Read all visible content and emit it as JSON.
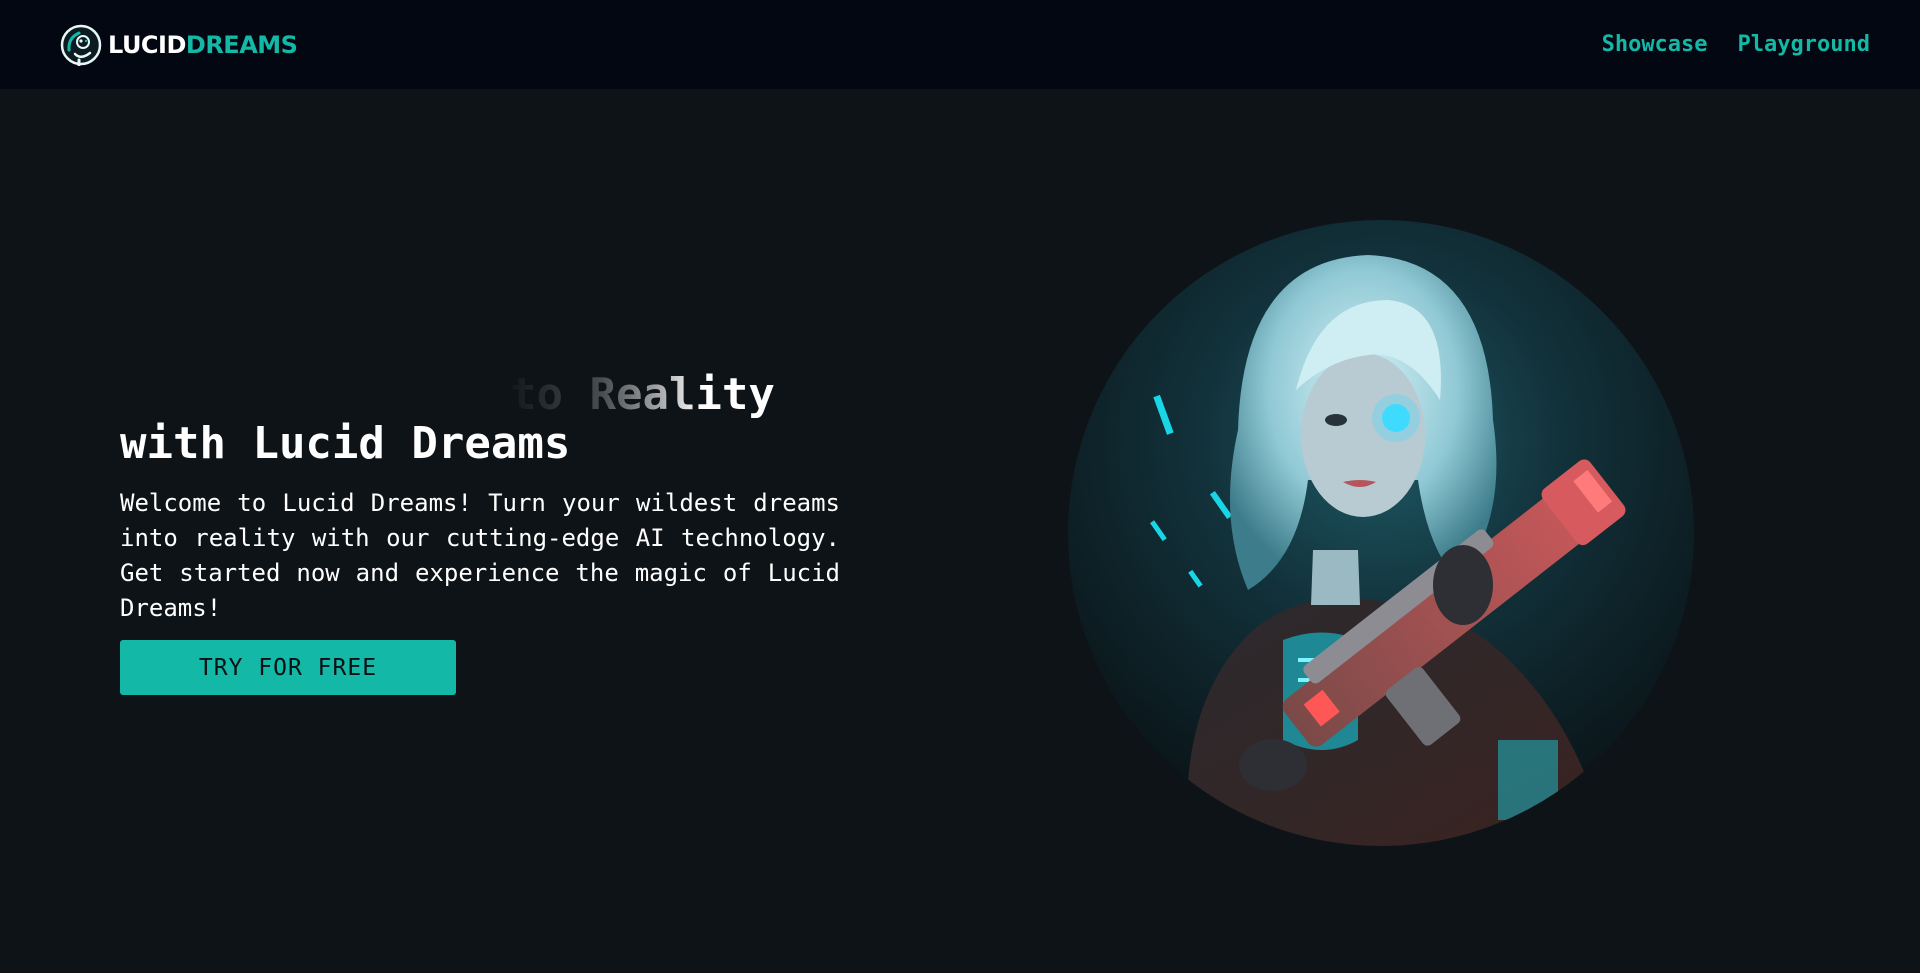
{
  "navbar": {
    "brand": {
      "logo_icon": "astronaut-logo-icon",
      "name_part1": "LUCID",
      "name_part2": "DREAMS"
    },
    "links": [
      {
        "label": "Showcase"
      },
      {
        "label": "Playground"
      }
    ]
  },
  "hero": {
    "headline_typing": "to Reality",
    "headline_main": "with Lucid Dreams",
    "description": "Welcome to Lucid Dreams! Turn your wildest dreams into reality with our cutting-edge AI technology. Get started now and experience the magic of Lucid Dreams!",
    "cta_label": "TRY FOR FREE",
    "image_icon": "cyberpunk-girl-illustration"
  },
  "colors": {
    "background": "#0e1317",
    "navbar_bg": "#020711",
    "accent": "#14b8a6",
    "text": "#ffffff"
  }
}
